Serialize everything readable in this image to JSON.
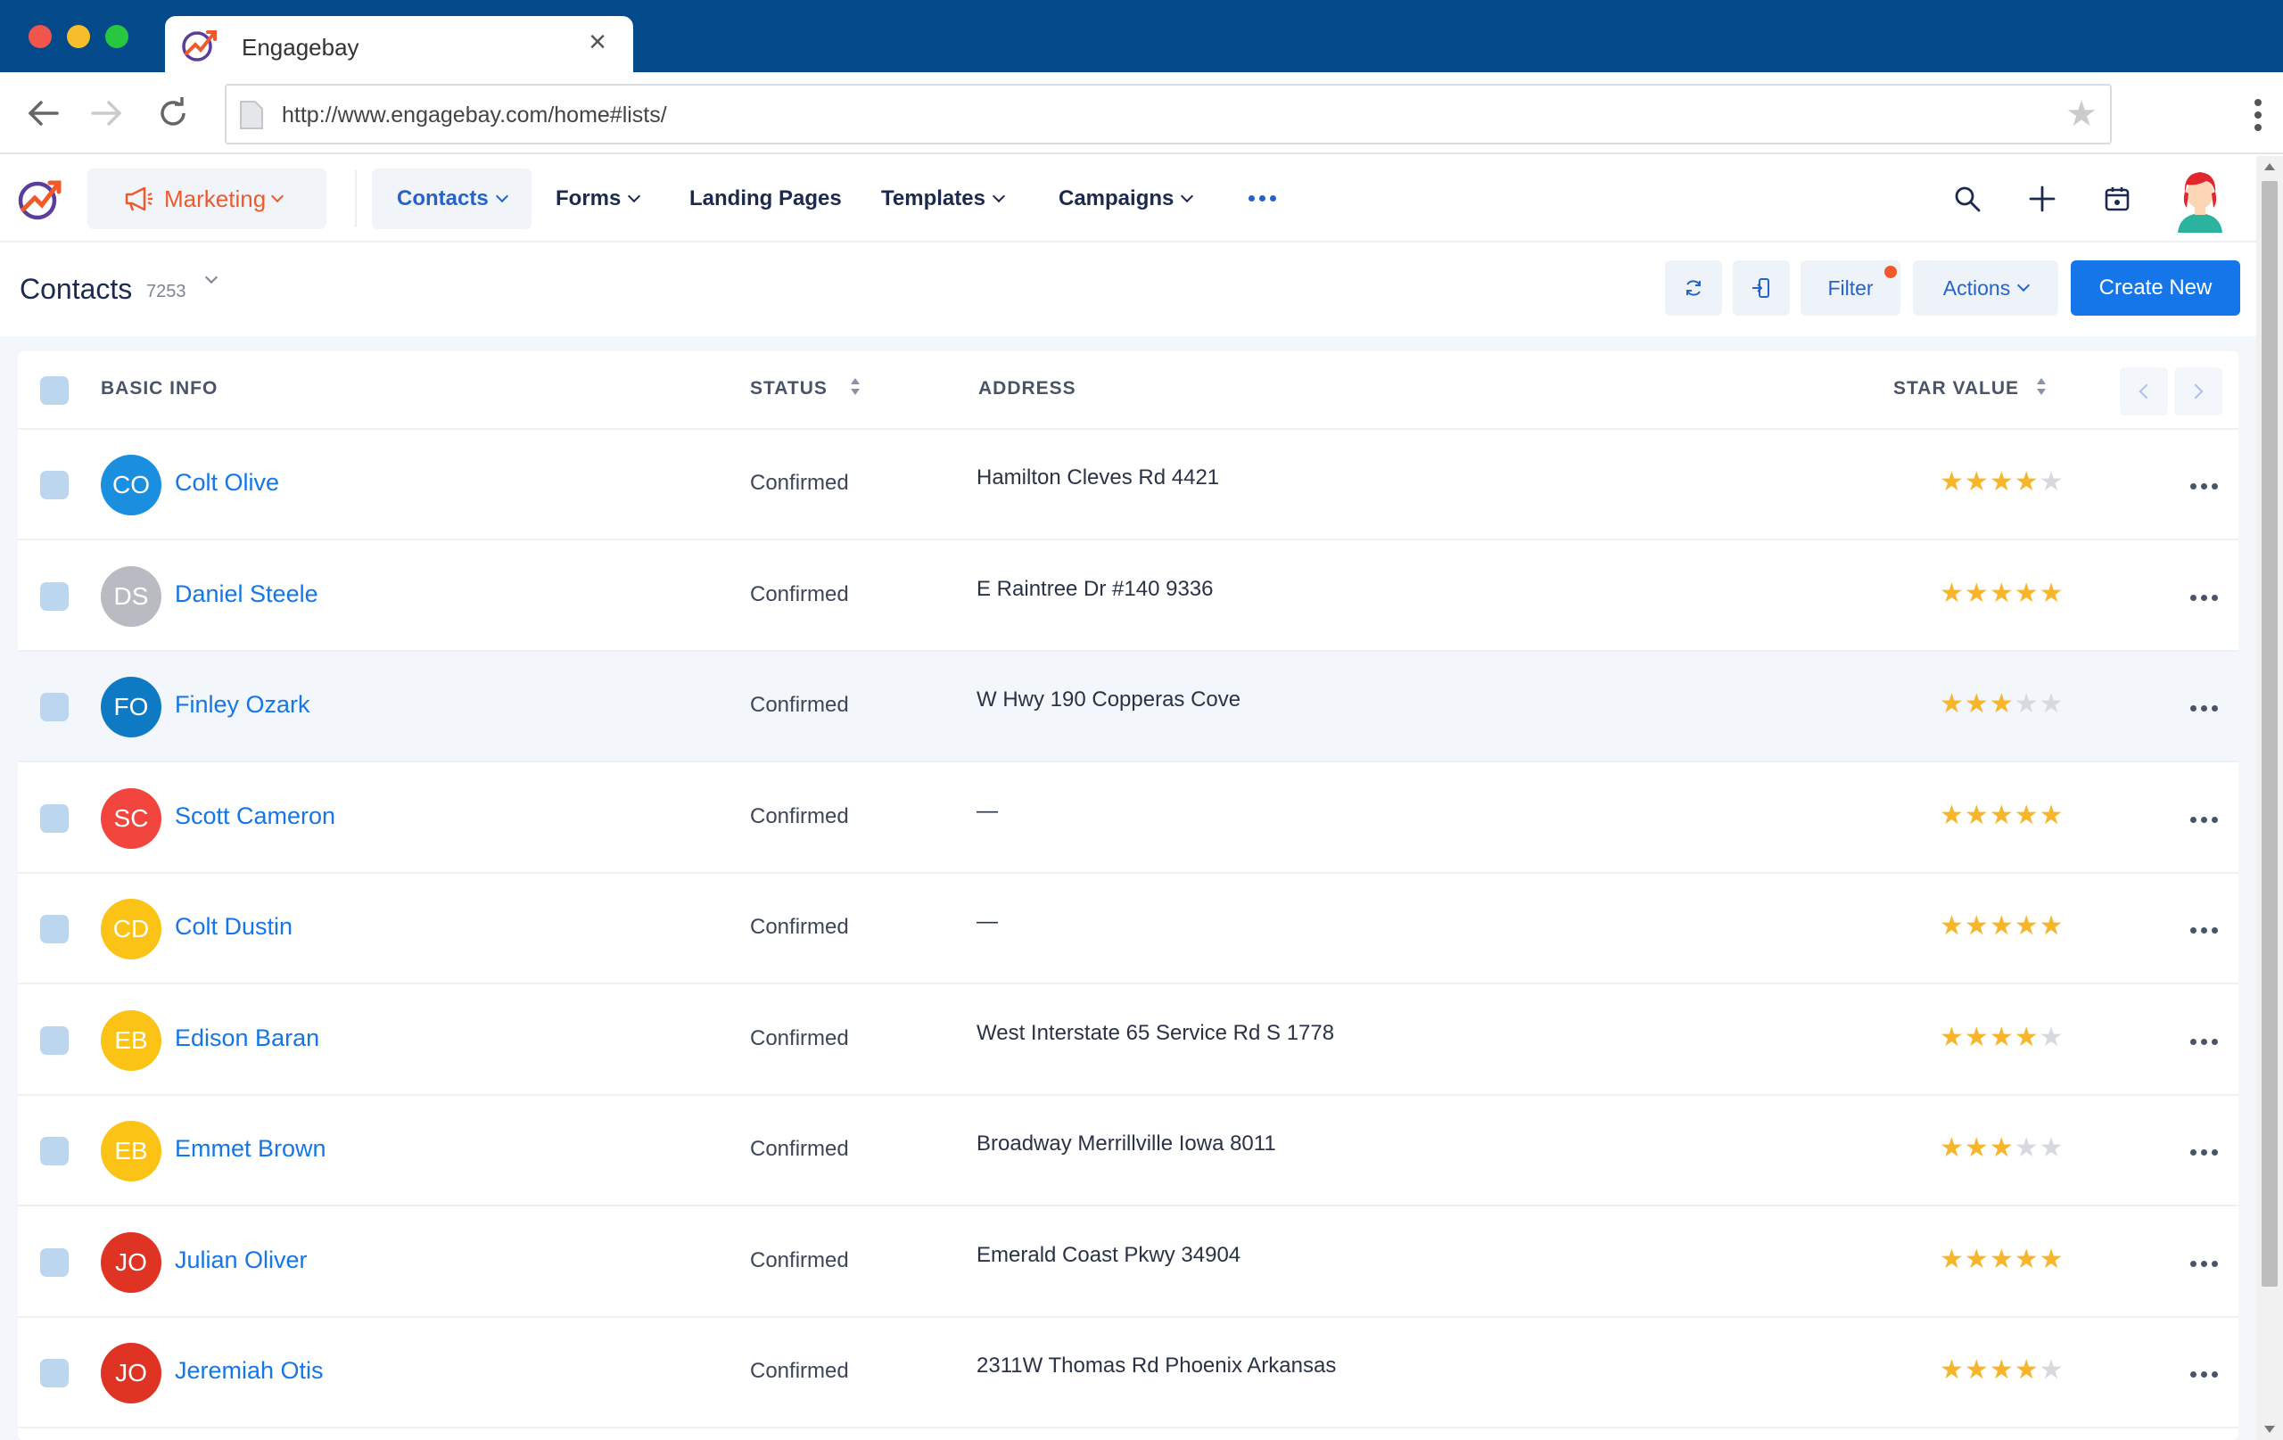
{
  "browser": {
    "tab_title": "Engagebay",
    "url": "http://www.engagebay.com/home#lists/"
  },
  "app": {
    "module_label": "Marketing",
    "nav": {
      "contacts": "Contacts",
      "forms": "Forms",
      "landing_pages": "Landing Pages",
      "templates": "Templates",
      "campaigns": "Campaigns"
    },
    "accent": "#1476e8",
    "brand_orange": "#f1592a"
  },
  "page": {
    "title": "Contacts",
    "count": "7253",
    "filter_label": "Filter",
    "actions_label": "Actions",
    "create_label": "Create New"
  },
  "table": {
    "columns": {
      "basic_info": "BASIC INFO",
      "status": "STATUS",
      "address": "ADDRESS",
      "star_value": "STAR VALUE"
    },
    "rows": [
      {
        "initials": "CO",
        "name": "Colt Olive",
        "status": "Confirmed",
        "address": "Hamilton Cleves Rd 4421",
        "stars": 4,
        "color": "#1a8fe0"
      },
      {
        "initials": "DS",
        "name": "Daniel Steele",
        "status": "Confirmed",
        "address": "E Raintree Dr #140 9336",
        "stars": 5,
        "color": "#b8bcc2"
      },
      {
        "initials": "FO",
        "name": "Finley Ozark",
        "status": "Confirmed",
        "address": "W Hwy 190 Copperas Cove",
        "stars": 3,
        "color": "#0f7ac4"
      },
      {
        "initials": "SC",
        "name": "Scott Cameron",
        "status": "Confirmed",
        "address": "—",
        "stars": 5,
        "color": "#f2453d"
      },
      {
        "initials": "CD",
        "name": "Colt Dustin",
        "status": "Confirmed",
        "address": "—",
        "stars": 5,
        "color": "#fbc315"
      },
      {
        "initials": "EB",
        "name": "Edison Baran",
        "status": "Confirmed",
        "address": "West Interstate 65 Service Rd S 1778",
        "stars": 4,
        "color": "#fbc315"
      },
      {
        "initials": "EB",
        "name": "Emmet Brown",
        "status": "Confirmed",
        "address": "Broadway Merrillville Iowa 8011",
        "stars": 3,
        "color": "#fbc315"
      },
      {
        "initials": "JO",
        "name": "Julian Oliver",
        "status": "Confirmed",
        "address": "Emerald Coast Pkwy 34904",
        "stars": 5,
        "color": "#df3324"
      },
      {
        "initials": "JO",
        "name": "Jeremiah Otis",
        "status": "Confirmed",
        "address": "2311W Thomas Rd Phoenix Arkansas",
        "stars": 4,
        "color": "#df3324"
      }
    ]
  }
}
